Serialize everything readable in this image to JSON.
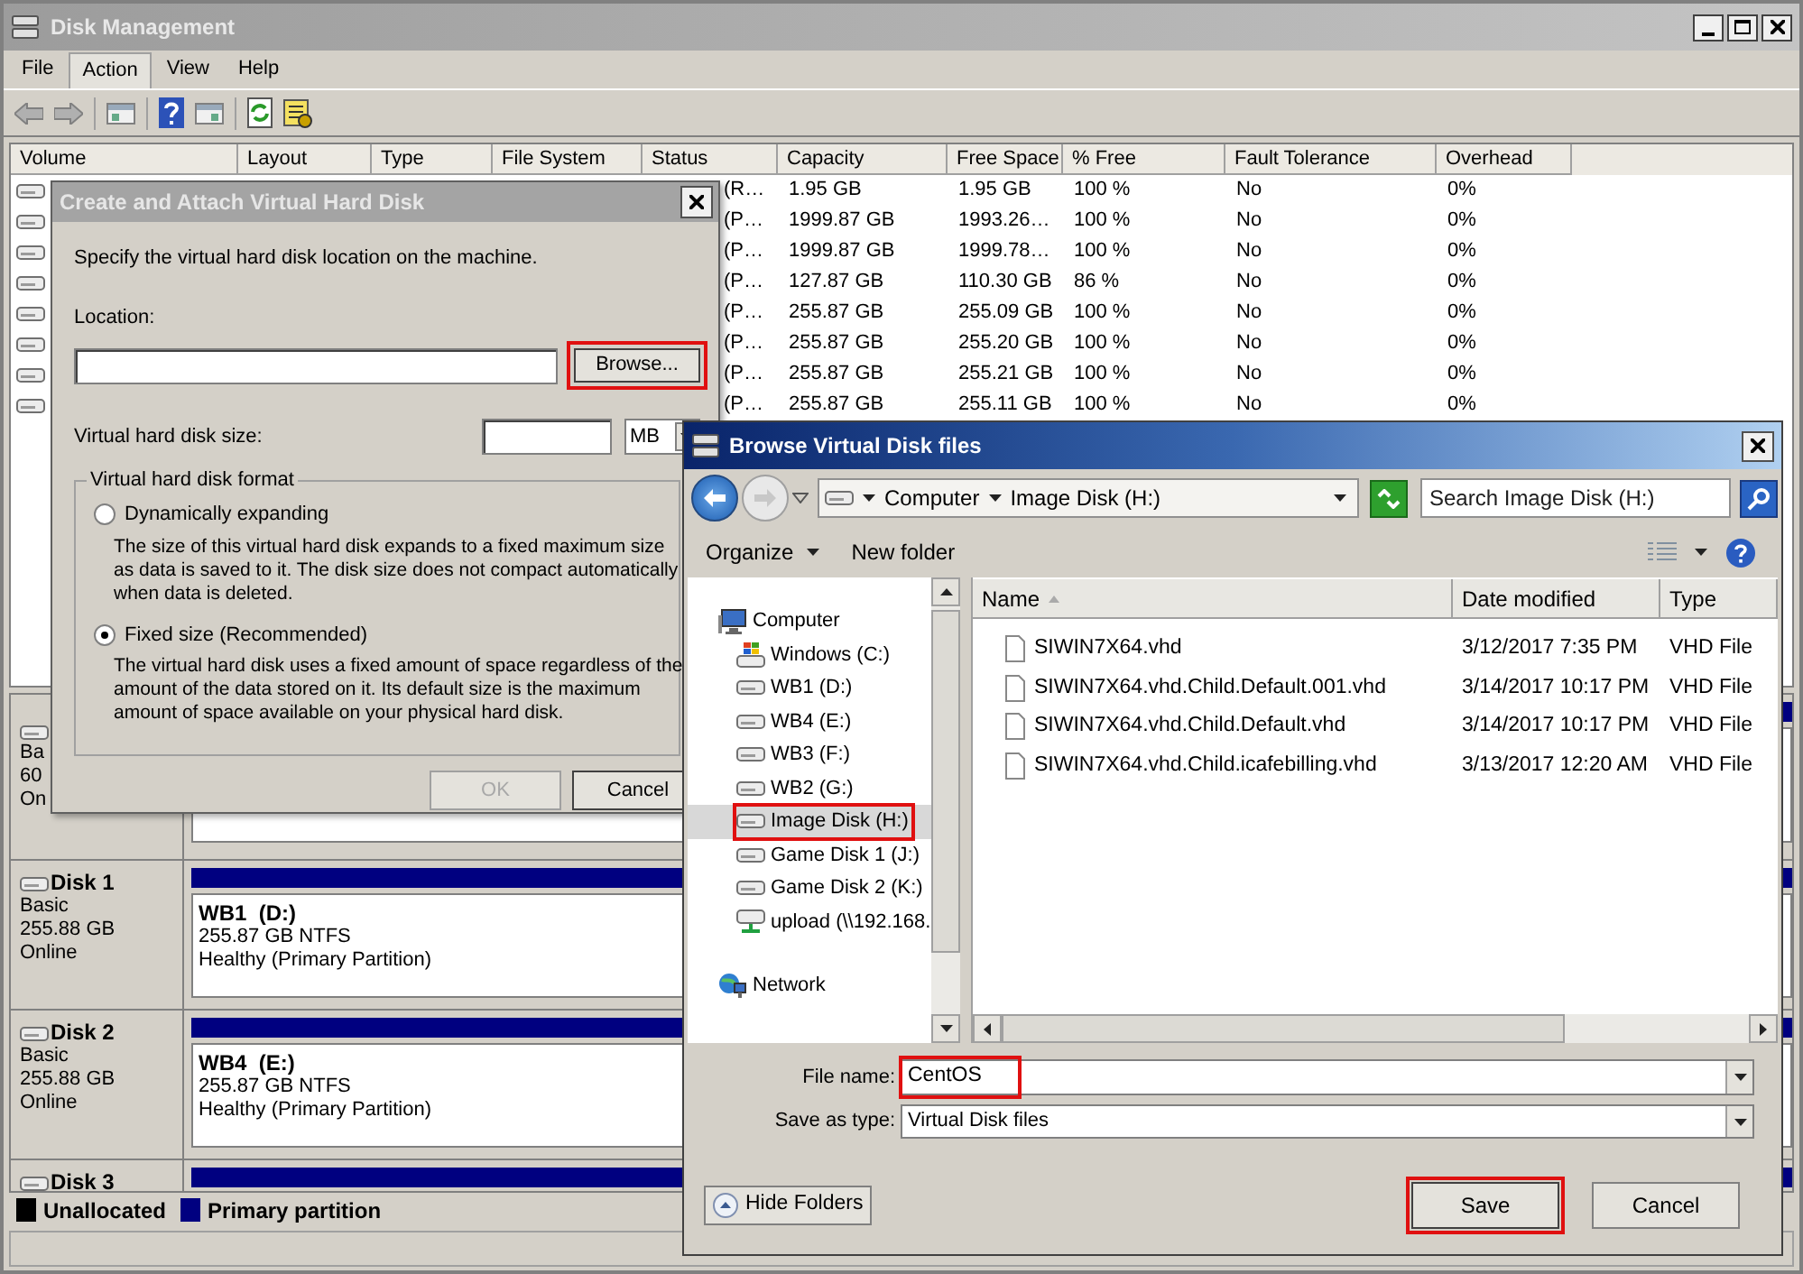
{
  "window": {
    "title": "Disk Management"
  },
  "menu": [
    {
      "label": "File",
      "selected": false
    },
    {
      "label": "Action",
      "selected": true
    },
    {
      "label": "View",
      "selected": false
    },
    {
      "label": "Help",
      "selected": false
    }
  ],
  "volume_table": {
    "columns": [
      "Volume",
      "Layout",
      "Type",
      "File System",
      "Status",
      "Capacity",
      "Free Space",
      "% Free",
      "Fault Tolerance",
      "Overhead"
    ],
    "rows": [
      {
        "status": "(R…",
        "capacity": "1.95 GB",
        "free_space": "1.95 GB",
        "percent_free": "100 %",
        "fault_tolerance": "No",
        "overhead": "0%"
      },
      {
        "status": "(P…",
        "capacity": "1999.87 GB",
        "free_space": "1993.26…",
        "percent_free": "100 %",
        "fault_tolerance": "No",
        "overhead": "0%"
      },
      {
        "status": "(P…",
        "capacity": "1999.87 GB",
        "free_space": "1999.78…",
        "percent_free": "100 %",
        "fault_tolerance": "No",
        "overhead": "0%"
      },
      {
        "status": "(P…",
        "capacity": "127.87 GB",
        "free_space": "110.30 GB",
        "percent_free": "86 %",
        "fault_tolerance": "No",
        "overhead": "0%"
      },
      {
        "status": "(P…",
        "capacity": "255.87 GB",
        "free_space": "255.09 GB",
        "percent_free": "100 %",
        "fault_tolerance": "No",
        "overhead": "0%"
      },
      {
        "status": "(P…",
        "capacity": "255.87 GB",
        "free_space": "255.20 GB",
        "percent_free": "100 %",
        "fault_tolerance": "No",
        "overhead": "0%"
      },
      {
        "status": "(P…",
        "capacity": "255.87 GB",
        "free_space": "255.21 GB",
        "percent_free": "100 %",
        "fault_tolerance": "No",
        "overhead": "0%"
      },
      {
        "status": "(P…",
        "capacity": "255.87 GB",
        "free_space": "255.11 GB",
        "percent_free": "100 %",
        "fault_tolerance": "No",
        "overhead": "0%"
      }
    ]
  },
  "disks": [
    {
      "label_lines": [
        "Ba",
        "60",
        "On"
      ]
    },
    {
      "name": "Disk 1",
      "label_lines": [
        "Basic",
        "255.88 GB",
        "Online"
      ],
      "partition": {
        "title": "WB1  (D:)",
        "size": "255.87 GB NTFS",
        "status": "Healthy (Primary Partition)"
      }
    },
    {
      "name": "Disk 2",
      "label_lines": [
        "Basic",
        "255.88 GB",
        "Online"
      ],
      "partition": {
        "title": "WB4  (E:)",
        "size": "255.87 GB NTFS",
        "status": "Healthy (Primary Partition)"
      }
    },
    {
      "name": "Disk 3"
    }
  ],
  "legend": [
    {
      "label": "Unallocated",
      "color": "#000000"
    },
    {
      "label": "Primary partition",
      "color": "#000080"
    }
  ],
  "create_dialog": {
    "title": "Create and Attach Virtual Hard Disk",
    "instruction": "Specify the virtual hard disk location on the machine.",
    "location_label": "Location:",
    "browse_button": {
      "label": "Browse...",
      "highlighted": true
    },
    "size_label": "Virtual hard disk size:",
    "size_unit": "MB",
    "format_group": {
      "title": "Virtual hard disk format",
      "options": [
        {
          "label": "Dynamically expanding",
          "description": "The size of this virtual hard disk expands to a fixed maximum size as data is saved to it. The disk size does not compact automatically when data is deleted.",
          "selected": false
        },
        {
          "label": "Fixed size (Recommended)",
          "description": "The virtual hard disk uses a fixed amount of space regardless of the amount of the data stored on it. Its default size is the maximum amount of space available on your physical hard disk.",
          "selected": true
        }
      ]
    },
    "buttons": [
      {
        "label": "OK",
        "disabled": true
      },
      {
        "label": "Cancel",
        "disabled": false
      }
    ]
  },
  "browse_dialog": {
    "title": "Browse Virtual Disk files",
    "breadcrumb": [
      "Computer",
      "Image Disk (H:)"
    ],
    "search_placeholder": "Search Image Disk (H:)",
    "toolbar": [
      "Organize",
      "New folder"
    ],
    "nav": [
      {
        "label": "Computer",
        "kind": "computer",
        "selected": false,
        "highlighted": false,
        "children": [
          {
            "label": "Windows (C:)",
            "kind": "system_drive",
            "selected": false,
            "highlighted": false
          },
          {
            "label": "WB1 (D:)",
            "kind": "drive",
            "selected": false,
            "highlighted": false
          },
          {
            "label": "WB4 (E:)",
            "kind": "drive",
            "selected": false,
            "highlighted": false
          },
          {
            "label": "WB3 (F:)",
            "kind": "drive",
            "selected": false,
            "highlighted": false
          },
          {
            "label": "WB2 (G:)",
            "kind": "drive",
            "selected": false,
            "highlighted": false
          },
          {
            "label": "Image Disk (H:)",
            "kind": "drive",
            "selected": true,
            "highlighted": true
          },
          {
            "label": "Game Disk 1 (J:)",
            "kind": "drive",
            "selected": false,
            "highlighted": false
          },
          {
            "label": "Game Disk 2 (K:)",
            "kind": "drive",
            "selected": false,
            "highlighted": false
          },
          {
            "label": "upload (\\\\192.168.",
            "kind": "network_drive",
            "selected": false,
            "highlighted": false
          }
        ]
      },
      {
        "label": "Network",
        "kind": "network",
        "selected": false,
        "highlighted": false
      }
    ],
    "columns": [
      "Name",
      "Date modified",
      "Type"
    ],
    "files": [
      {
        "name": "SIWIN7X64.vhd",
        "date": "3/12/2017 7:35 PM",
        "type": "VHD File"
      },
      {
        "name": "SIWIN7X64.vhd.Child.Default.001.vhd",
        "date": "3/14/2017 10:17 PM",
        "type": "VHD File"
      },
      {
        "name": "SIWIN7X64.vhd.Child.Default.vhd",
        "date": "3/14/2017 10:17 PM",
        "type": "VHD File"
      },
      {
        "name": "SIWIN7X64.vhd.Child.icafebilling.vhd",
        "date": "3/13/2017 12:20 AM",
        "type": "VHD File"
      }
    ],
    "file_name_label": "File name:",
    "file_name": "CentOS",
    "file_name_highlighted": true,
    "save_type_label": "Save as type:",
    "save_type": "Virtual Disk files",
    "hide_folders": "Hide Folders",
    "buttons": [
      {
        "label": "Save",
        "highlighted": true
      },
      {
        "label": "Cancel",
        "highlighted": false
      }
    ]
  }
}
